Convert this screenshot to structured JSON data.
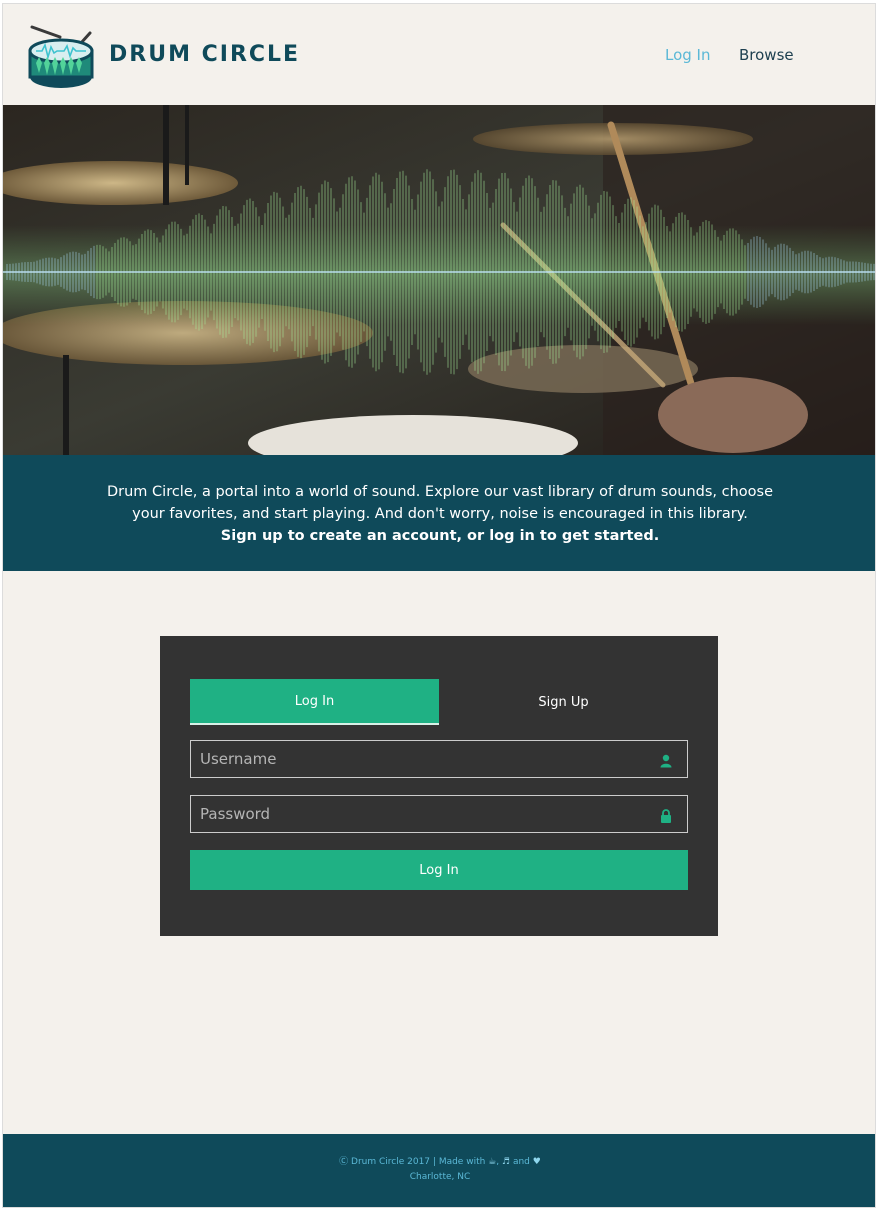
{
  "app": {
    "brand": "DRUM CIRCLE"
  },
  "nav": {
    "login": "Log In",
    "browse": "Browse"
  },
  "intro": {
    "text": "Drum Circle, a portal into a world of sound. Explore our vast library of drum sounds, choose your favorites, and start playing. And don't worry, noise is encouraged in this library.",
    "cta": "Sign up to create an account, or log in to get started."
  },
  "auth": {
    "tabs": {
      "login": "Log In",
      "signup": "Sign Up"
    },
    "active_tab": "login",
    "username": {
      "placeholder": "Username",
      "value": "",
      "icon": "user-icon"
    },
    "password": {
      "placeholder": "Password",
      "value": "",
      "icon": "lock-icon"
    },
    "submit": "Log In"
  },
  "footer": {
    "copyright": "Drum Circle 2017",
    "made_with": "| Made with",
    "conj": "and",
    "location": "Charlotte, NC"
  },
  "colors": {
    "accent": "#1fb184",
    "brand_dark": "#0f4a5a",
    "link": "#5bb8d6",
    "panel": "#333333",
    "background": "#f4f1ec"
  }
}
